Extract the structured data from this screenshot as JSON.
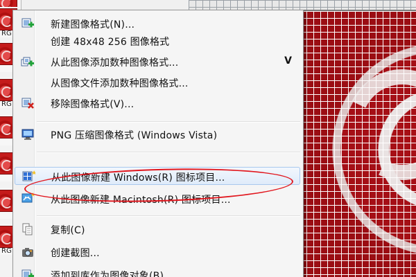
{
  "thumbnails": [
    {
      "label": "",
      "top": 0
    },
    {
      "label": "RG",
      "top": 0
    },
    {
      "label": "RG",
      "top": 0
    },
    {
      "label": "",
      "top": 0
    },
    {
      "label": "",
      "top": 0
    },
    {
      "label": "",
      "top": 0
    },
    {
      "label": "",
      "top": 0
    },
    {
      "label": "RG",
      "top": 0
    }
  ],
  "menu": {
    "items": [
      {
        "label": "新建图像格式(N)...",
        "icon": "new-format-icon",
        "shortcut": ""
      },
      {
        "label": "创建 48x48 256 图像格式",
        "icon": "",
        "shortcut": ""
      },
      {
        "label": "从此图像添加数种图像格式...",
        "icon": "add-formats-icon",
        "shortcut": "V"
      },
      {
        "label": "从图像文件添加数种图像格式...",
        "icon": "",
        "shortcut": ""
      },
      {
        "label": "移除图像格式(V)...",
        "icon": "remove-format-icon",
        "shortcut": ""
      },
      {
        "label": "PNG 压缩图像格式 (Windows Vista)",
        "icon": "png-monitor-icon",
        "shortcut": ""
      },
      {
        "label": "从此图像新建 Windows(R) 图标项目...",
        "icon": "new-windows-icon-project-icon",
        "shortcut": ""
      },
      {
        "label": "从此图像新建 Macintosh(R) 图标项目...",
        "icon": "new-mac-icon-project-icon",
        "shortcut": ""
      },
      {
        "label": "复制(C)",
        "icon": "copy-icon",
        "shortcut": ""
      },
      {
        "label": "创建截图...",
        "icon": "screenshot-icon",
        "shortcut": ""
      },
      {
        "label": "添加到库作为图像对象(B)...",
        "icon": "library-icon",
        "shortcut": ""
      }
    ],
    "highlighted_index": 6
  },
  "colors": {
    "highlight_border": "#a8c8ee",
    "annotation": "#e1161d",
    "canvas_red": "#a70f16"
  }
}
